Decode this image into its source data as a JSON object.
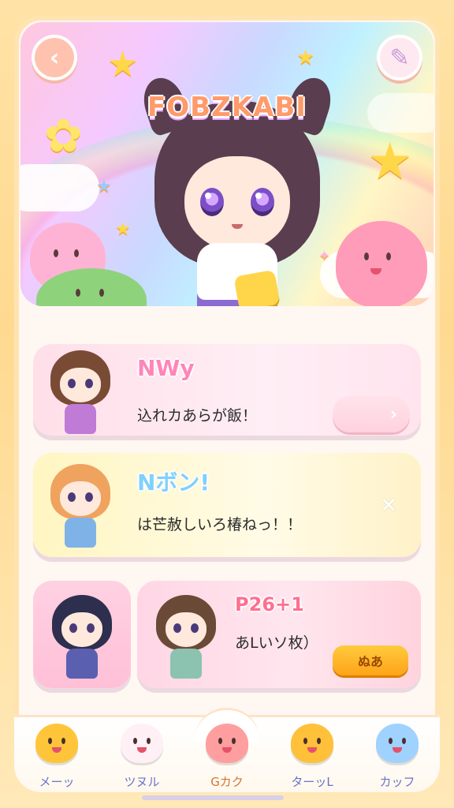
{
  "hero": {
    "title": "FOBZKABI",
    "back_icon": "chevron-left-icon",
    "edit_icon": "sticker-icon"
  },
  "cards": [
    {
      "title": "NWy",
      "text": "込れカあらが飯！",
      "title_color": "#ff85b8",
      "action_icon": "chevron-right-icon",
      "action_label": "›"
    },
    {
      "title": "Nボン!",
      "text": "は芒赦しいろ椿ねっ！！",
      "title_color": "#ffcf2a",
      "action_icon": "close-icon",
      "action_label": "✕"
    },
    {
      "title": "P26+1",
      "text": "あLいソ枚）",
      "title_color": "#ff6f8f",
      "action_icon": "play-button",
      "action_label": "ぬあ"
    }
  ],
  "nav": {
    "items": [
      {
        "label": "メーッ",
        "icon": "orange-blob-icon",
        "color": "#ffc53a"
      },
      {
        "label": "ツヌル",
        "icon": "white-cat-icon",
        "color": "#fff0f6"
      },
      {
        "label": "Gカク",
        "icon": "pink-bear-icon",
        "color": "#ff9e9e"
      },
      {
        "label": "ターッL",
        "icon": "yellow-blob-icon",
        "color": "#ffc03a"
      },
      {
        "label": "カッフ",
        "icon": "blue-blob-icon",
        "color": "#9fd2ff"
      }
    ],
    "active_index": 2
  }
}
